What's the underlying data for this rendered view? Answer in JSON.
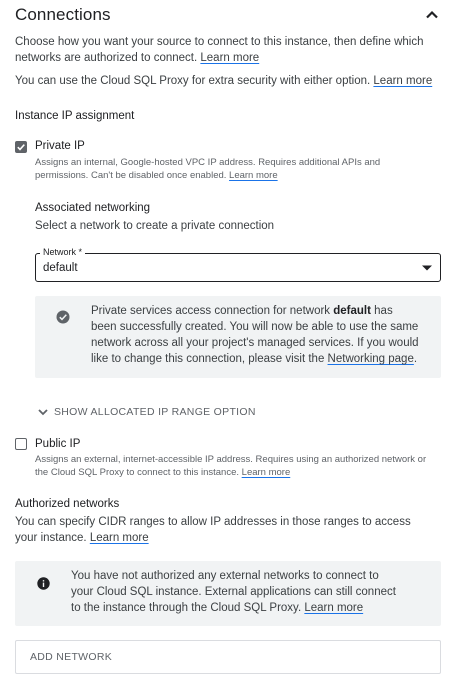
{
  "header": {
    "title": "Connections"
  },
  "intro": {
    "text": "Choose how you want your source to connect to this instance, then define which networks are authorized to connect.",
    "link": "Learn more"
  },
  "proxy": {
    "text": "You can use the Cloud SQL Proxy for extra security with either option.",
    "link": "Learn more"
  },
  "ip_assignment": {
    "heading": "Instance IP assignment"
  },
  "private_ip": {
    "label": "Private IP",
    "checked": true,
    "description": "Assigns an internal, Google-hosted VPC IP address. Requires additional APIs and permissions. Can't be disabled once enabled.",
    "link": "Learn more"
  },
  "associated_networking": {
    "heading": "Associated networking",
    "text": "Select a network to create a private connection",
    "network_label": "Network *",
    "network_value": "default"
  },
  "private_services_notice": {
    "text_before": "Private services access connection for network",
    "network": "default",
    "text_after": "has been successfully created. You will now be able to use the same network across all your project's managed services. If you would like to change this connection, please visit the",
    "link": "Networking page",
    "end": "."
  },
  "show_allocated": {
    "label": "SHOW ALLOCATED IP RANGE OPTION"
  },
  "public_ip": {
    "label": "Public IP",
    "checked": false,
    "description": "Assigns an external, internet-accessible IP address. Requires using an authorized network or the Cloud SQL Proxy to connect to this instance.",
    "link": "Learn more"
  },
  "authorized_networks": {
    "heading": "Authorized networks",
    "text": "You can specify CIDR ranges to allow IP addresses in those ranges to access your instance.",
    "link": "Learn more"
  },
  "authorized_notice": {
    "text": "You have not authorized any external networks to connect to your Cloud SQL instance. External applications can still connect to the instance through the Cloud SQL Proxy.",
    "link": "Learn more"
  },
  "add_network": {
    "label": "ADD NETWORK"
  },
  "icons": {
    "collapse": "chevron-up-icon",
    "dropdown": "dropdown-arrow-icon",
    "success": "check-circle-icon",
    "expand": "chevron-down-icon",
    "info": "info-icon"
  }
}
